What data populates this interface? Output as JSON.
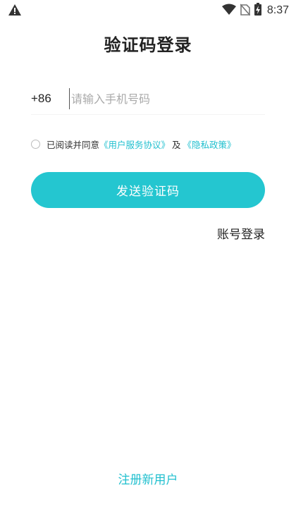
{
  "status_bar": {
    "time": "8:37",
    "icons": [
      "warning-icon",
      "wifi-icon",
      "no-sim-icon",
      "battery-charging-icon"
    ]
  },
  "page": {
    "title": "验证码登录"
  },
  "phone": {
    "country_code": "+86",
    "placeholder": "请输入手机号码",
    "value": ""
  },
  "agreement": {
    "prefix": "已阅读并同意",
    "user_agreement": "《用户服务协议》",
    "between": "及",
    "privacy_policy": "《隐私政策》",
    "checked": false
  },
  "actions": {
    "send_code": "发送验证码",
    "account_login": "账号登录",
    "register": "注册新用户"
  },
  "colors": {
    "accent": "#24c6d0",
    "link": "#22c0cf",
    "text": "#222222"
  }
}
